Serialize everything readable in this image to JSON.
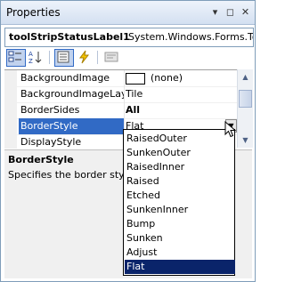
{
  "window": {
    "title": "Properties"
  },
  "title_buttons": {
    "dropdown": "▾",
    "pin": "◻",
    "close": "✕"
  },
  "object_selector": {
    "name": "toolStripStatusLabel1",
    "type": "System.Windows.Forms.To"
  },
  "toolbar": {
    "buttons": [
      "categorized-icon",
      "alphabetical-icon",
      "properties-icon",
      "events-icon",
      "property-pages-icon"
    ]
  },
  "properties": [
    {
      "name": "BackgroundImage",
      "value": "(none)"
    },
    {
      "name": "BackgroundImageLayout",
      "value": "Tile"
    },
    {
      "name": "BorderSides",
      "value": "All"
    },
    {
      "name": "BorderStyle",
      "value": "Flat"
    },
    {
      "name": "DisplayStyle",
      "value": ""
    }
  ],
  "description": {
    "title": "BorderStyle",
    "text": "Specifies the border style"
  },
  "dropdown": {
    "options": [
      "RaisedOuter",
      "SunkenOuter",
      "RaisedInner",
      "Raised",
      "Etched",
      "SunkenInner",
      "Bump",
      "Sunken",
      "Adjust",
      "Flat"
    ],
    "selected": "Flat"
  },
  "colors": {
    "selection": "#316ac5",
    "dropdown_selection": "#0a246a",
    "border": "#7f9db9"
  }
}
